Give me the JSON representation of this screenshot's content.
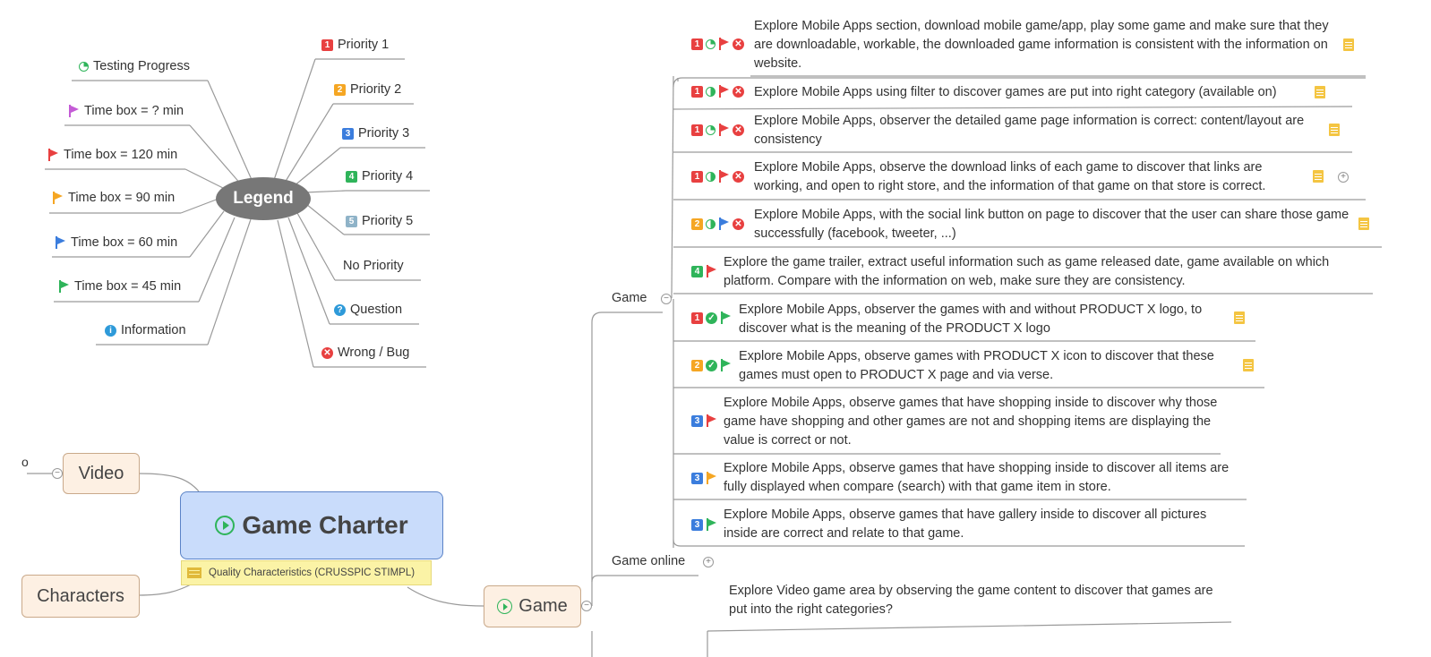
{
  "legend": {
    "title": "Legend",
    "left_items": [
      {
        "label": "Testing Progress",
        "icon": "progress-icon"
      },
      {
        "label": "Time box = ? min",
        "icon": "flag-icon",
        "color": "#c45bd6"
      },
      {
        "label": "Time box = 120 min",
        "icon": "flag-icon",
        "color": "#e84040"
      },
      {
        "label": "Time box = 90 min",
        "icon": "flag-icon",
        "color": "#f5a623"
      },
      {
        "label": "Time box = 60 min",
        "icon": "flag-icon",
        "color": "#3b7ddd"
      },
      {
        "label": "Time box = 45 min",
        "icon": "flag-icon",
        "color": "#2fb45a"
      },
      {
        "label": "Information",
        "icon": "info-icon"
      }
    ],
    "right_items": [
      {
        "label": "Priority 1",
        "badge": "1"
      },
      {
        "label": "Priority 2",
        "badge": "2"
      },
      {
        "label": "Priority 3",
        "badge": "3"
      },
      {
        "label": "Priority 4",
        "badge": "4"
      },
      {
        "label": "Priority 5",
        "badge": "5"
      },
      {
        "label": "No Priority"
      },
      {
        "label": "Question",
        "icon": "question-icon"
      },
      {
        "label": "Wrong / Bug",
        "icon": "bug-icon"
      }
    ]
  },
  "central": {
    "title": "Game Charter",
    "label": "Quality Characteristics (CRUSSPIC STIMPL)"
  },
  "left_topics": {
    "video": "Video",
    "characters": "Characters",
    "cut_text": "o"
  },
  "game_node": {
    "title": "Game"
  },
  "branches": {
    "game": "Game",
    "game_online": "Game online"
  },
  "tasks": [
    {
      "text": "Explore Mobile Apps section, download mobile game/app, play some game and make sure that they are downloadable, workable, the downloaded game information is consistent with the information on website.",
      "priority": "1",
      "progress": "quarter",
      "flag_color": "#e84040",
      "bug": true,
      "note": true
    },
    {
      "text": "Explore Mobile Apps using filter to discover games are put into right category (available on)",
      "priority": "1",
      "progress": "half",
      "flag_color": "#e84040",
      "bug": true,
      "note": true
    },
    {
      "text": "Explore Mobile Apps, observer the detailed game page information is correct: content/layout are consistency",
      "priority": "1",
      "progress": "quarter",
      "flag_color": "#e84040",
      "bug": true,
      "note": true
    },
    {
      "text": "Explore Mobile Apps, observe the download links of each game to discover that links are working, and open to right store, and the information of that game on that store is correct.",
      "priority": "1",
      "progress": "half",
      "flag_color": "#e84040",
      "bug": true,
      "note": true
    },
    {
      "text": "Explore Mobile Apps, with the social link button on page to discover that the user can share those game successfully (facebook, tweeter, ...)",
      "priority": "2",
      "progress": "half",
      "flag_color": "#3b7ddd",
      "bug": true,
      "note": true
    },
    {
      "text": "Explore the game trailer, extract useful information such as game released date, game available on which platform. Compare with the information on web, make sure they are consistency.",
      "priority": "4",
      "flag_color": "#e84040"
    },
    {
      "text": "Explore Mobile Apps, observer the games with and without PRODUCT X logo, to discover what is the meaning of the PRODUCT X logo",
      "priority": "1",
      "done": true,
      "flag_color": "#2fb45a",
      "note": true
    },
    {
      "text": "Explore Mobile Apps, observe games with PRODUCT X icon to discover that these games must open to PRODUCT X page and via verse.",
      "priority": "2",
      "done": true,
      "flag_color": "#2fb45a",
      "note": true
    },
    {
      "text": "Explore Mobile Apps, observe games that have shopping inside to discover why those game have shopping and other games are not and shopping items are displaying the value is correct or not.",
      "priority": "3",
      "flag_color": "#e84040"
    },
    {
      "text": "Explore Mobile Apps, observe games that have shopping inside to discover all items are fully displayed when compare (search) with that game item in store.",
      "priority": "3",
      "flag_color": "#f5a623"
    },
    {
      "text": "Explore Mobile Apps, observe games that have gallery inside to discover all pictures inside are correct and relate to that game.",
      "priority": "3",
      "flag_color": "#2fb45a"
    }
  ],
  "video_task": {
    "text": "Explore Video game area by observing the game content to discover that games are put into the right categories?"
  }
}
